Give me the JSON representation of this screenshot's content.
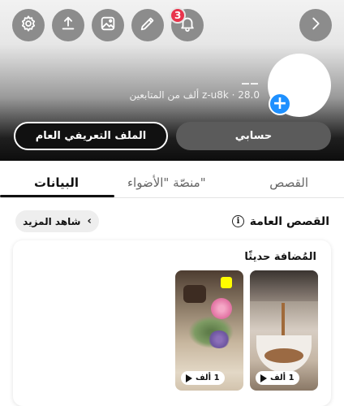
{
  "header": {
    "notification_count": "3",
    "display_name": "__",
    "stats": "z-u8k · 28.0 ألف من المتابعين",
    "account_button": "حسابي",
    "public_profile_button": "الملف التعريفي العام"
  },
  "icons": {
    "settings": "gear-icon",
    "share": "share-icon",
    "image": "image-icon",
    "edit": "pencil-icon",
    "notifications": "bell-icon",
    "forward": "chevron-right-icon",
    "add": "plus-icon",
    "info": "info-icon",
    "see_more": "chevron-left-icon",
    "play": "play-icon"
  },
  "colors": {
    "badge": "#e8344c",
    "add_button": "#1e90ff",
    "account_button": "#5b5b5b",
    "public_button": "#111111"
  },
  "tabs": [
    {
      "label": "القصص",
      "active": false
    },
    {
      "label": "منصّة \"الأضواء\"",
      "active": false
    },
    {
      "label": "البيانات",
      "active": true
    }
  ],
  "public_stories": {
    "title": "القصص العامة",
    "see_more": "شاهد المزيد",
    "recently_added": "المُضافة حديثًا",
    "items": [
      {
        "views": "1 ألف"
      },
      {
        "views": "1 ألف"
      }
    ]
  }
}
